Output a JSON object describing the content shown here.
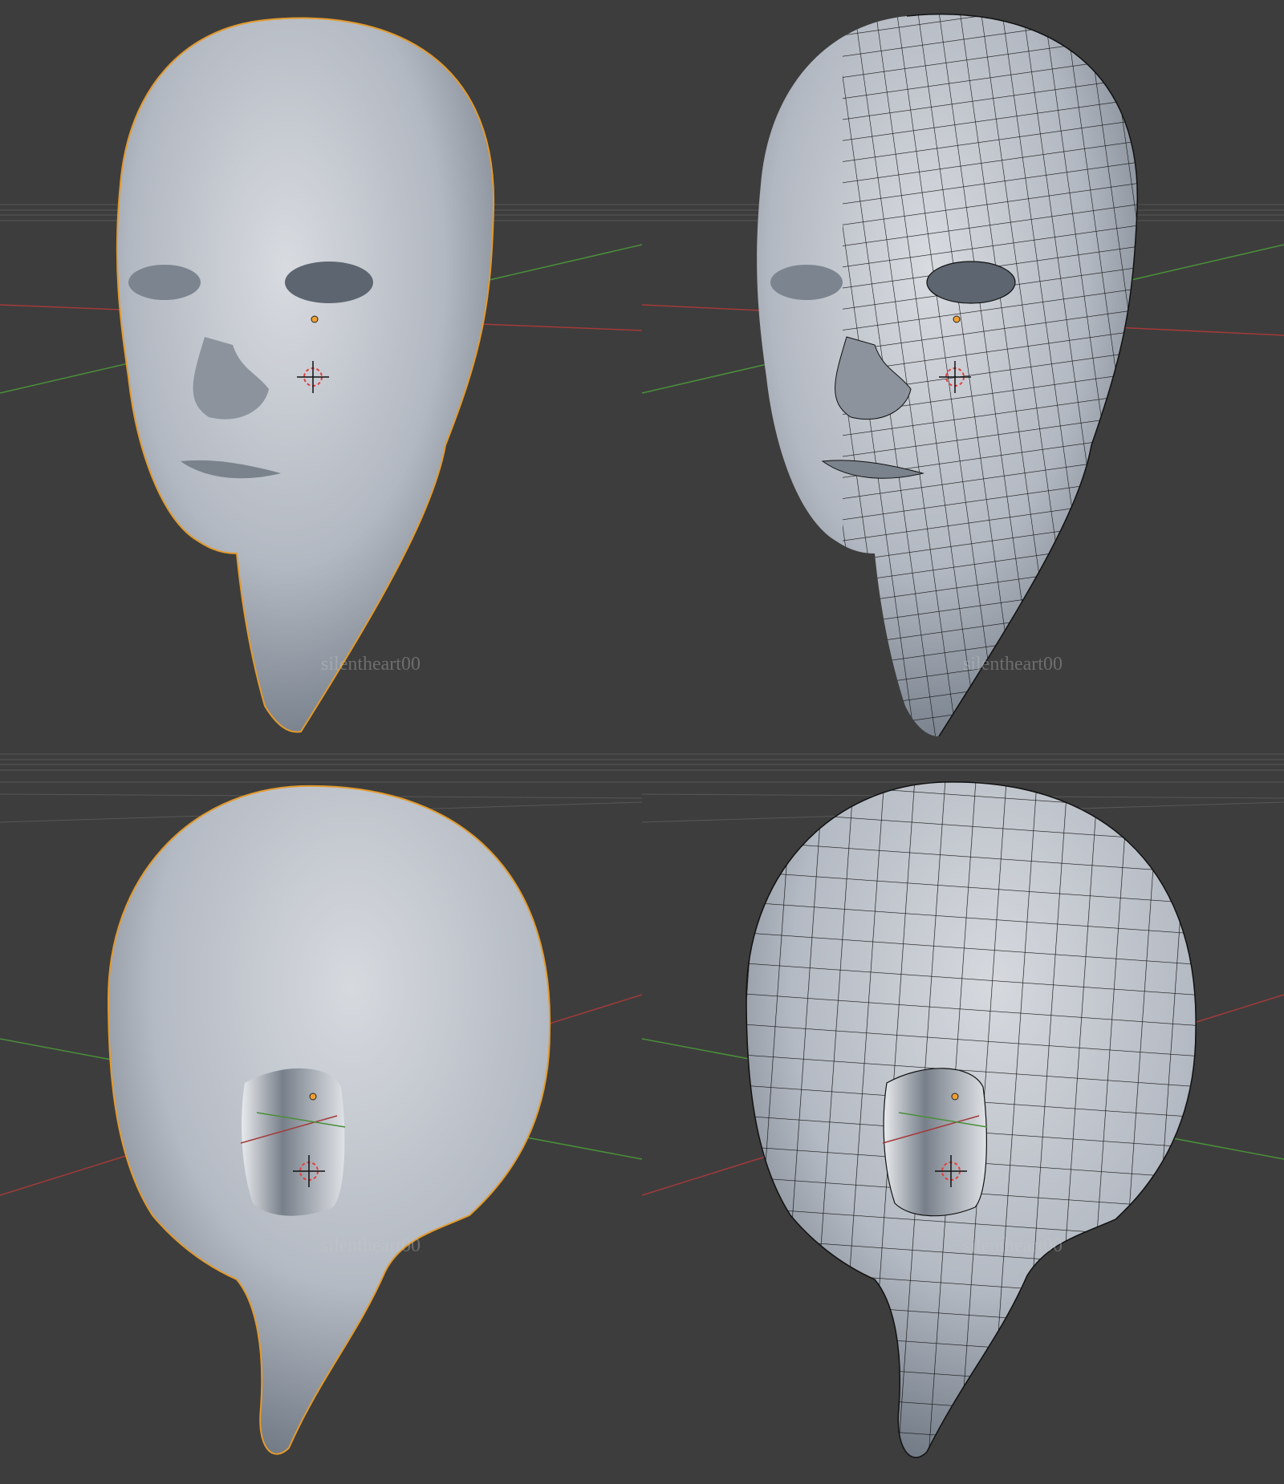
{
  "viewports": [
    {
      "id": "front-solid",
      "view": "front",
      "shading": "solid",
      "watermark": "silentheart00"
    },
    {
      "id": "front-wire",
      "view": "front",
      "shading": "solid+wireframe",
      "watermark": "silentheart00"
    },
    {
      "id": "back-solid",
      "view": "back",
      "shading": "solid",
      "watermark": "silentheart00"
    },
    {
      "id": "back-wire",
      "view": "back",
      "shading": "solid+wireframe",
      "watermark": "silentheart00"
    }
  ],
  "colors": {
    "background": "#3d3d3d",
    "grid_line": "#555555",
    "x_axis": "#a33a3a",
    "y_axis": "#4a8f3a",
    "mesh_light": "#d0d4d9",
    "mesh_dark": "#6c7480",
    "selection_outline": "#e39a2c",
    "wire": "#111111",
    "origin": "#f0a030",
    "cursor_red": "#e04040"
  },
  "icons": {
    "cursor": "3d-cursor-icon",
    "origin": "object-origin-icon"
  }
}
